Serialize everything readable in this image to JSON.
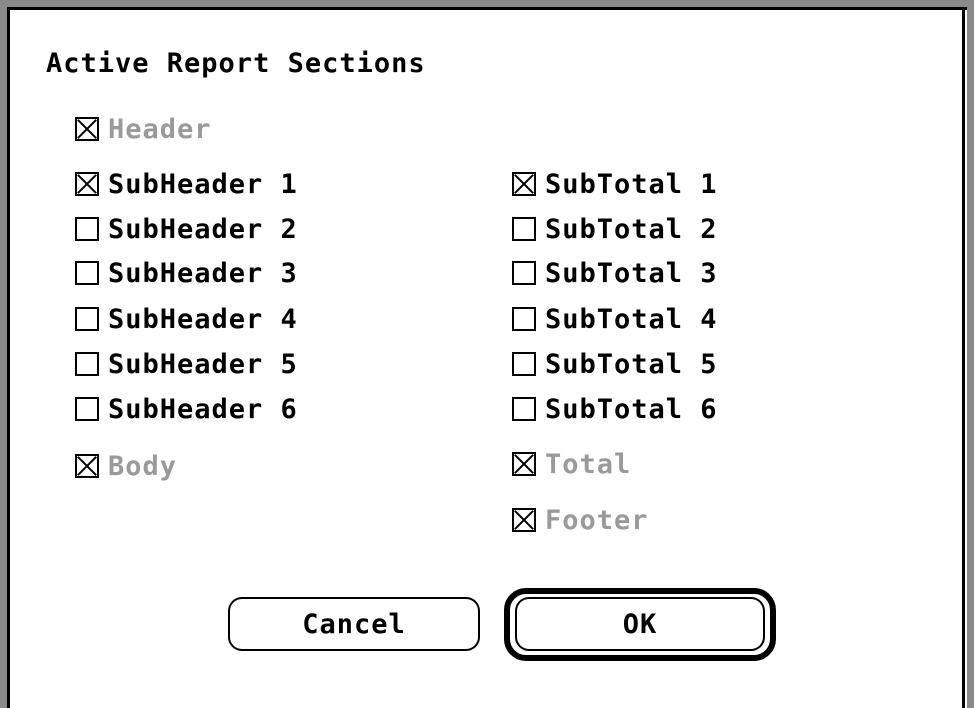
{
  "dialog": {
    "title": "Active Report Sections",
    "left_column": [
      {
        "label": "Header",
        "checked": true,
        "enabled": false
      },
      {
        "label": "SubHeader 1",
        "checked": true,
        "enabled": true
      },
      {
        "label": "SubHeader 2",
        "checked": false,
        "enabled": true
      },
      {
        "label": "SubHeader 3",
        "checked": false,
        "enabled": true
      },
      {
        "label": "SubHeader 4",
        "checked": false,
        "enabled": true
      },
      {
        "label": "SubHeader 5",
        "checked": false,
        "enabled": true
      },
      {
        "label": "SubHeader 6",
        "checked": false,
        "enabled": true
      },
      {
        "label": "Body",
        "checked": true,
        "enabled": false
      }
    ],
    "right_column": [
      {
        "label": "SubTotal 1",
        "checked": true,
        "enabled": true
      },
      {
        "label": "SubTotal 2",
        "checked": false,
        "enabled": true
      },
      {
        "label": "SubTotal 3",
        "checked": false,
        "enabled": true
      },
      {
        "label": "SubTotal 4",
        "checked": false,
        "enabled": true
      },
      {
        "label": "SubTotal 5",
        "checked": false,
        "enabled": true
      },
      {
        "label": "SubTotal 6",
        "checked": false,
        "enabled": true
      },
      {
        "label": "Total",
        "checked": true,
        "enabled": false
      },
      {
        "label": "Footer",
        "checked": true,
        "enabled": false
      }
    ],
    "buttons": {
      "cancel_label": "Cancel",
      "ok_label": "OK"
    }
  },
  "colors": {
    "frame": "#000000",
    "frame_grey": "#8a8a8a",
    "disabled_text": "#9a9a9a",
    "background": "#ffffff"
  }
}
